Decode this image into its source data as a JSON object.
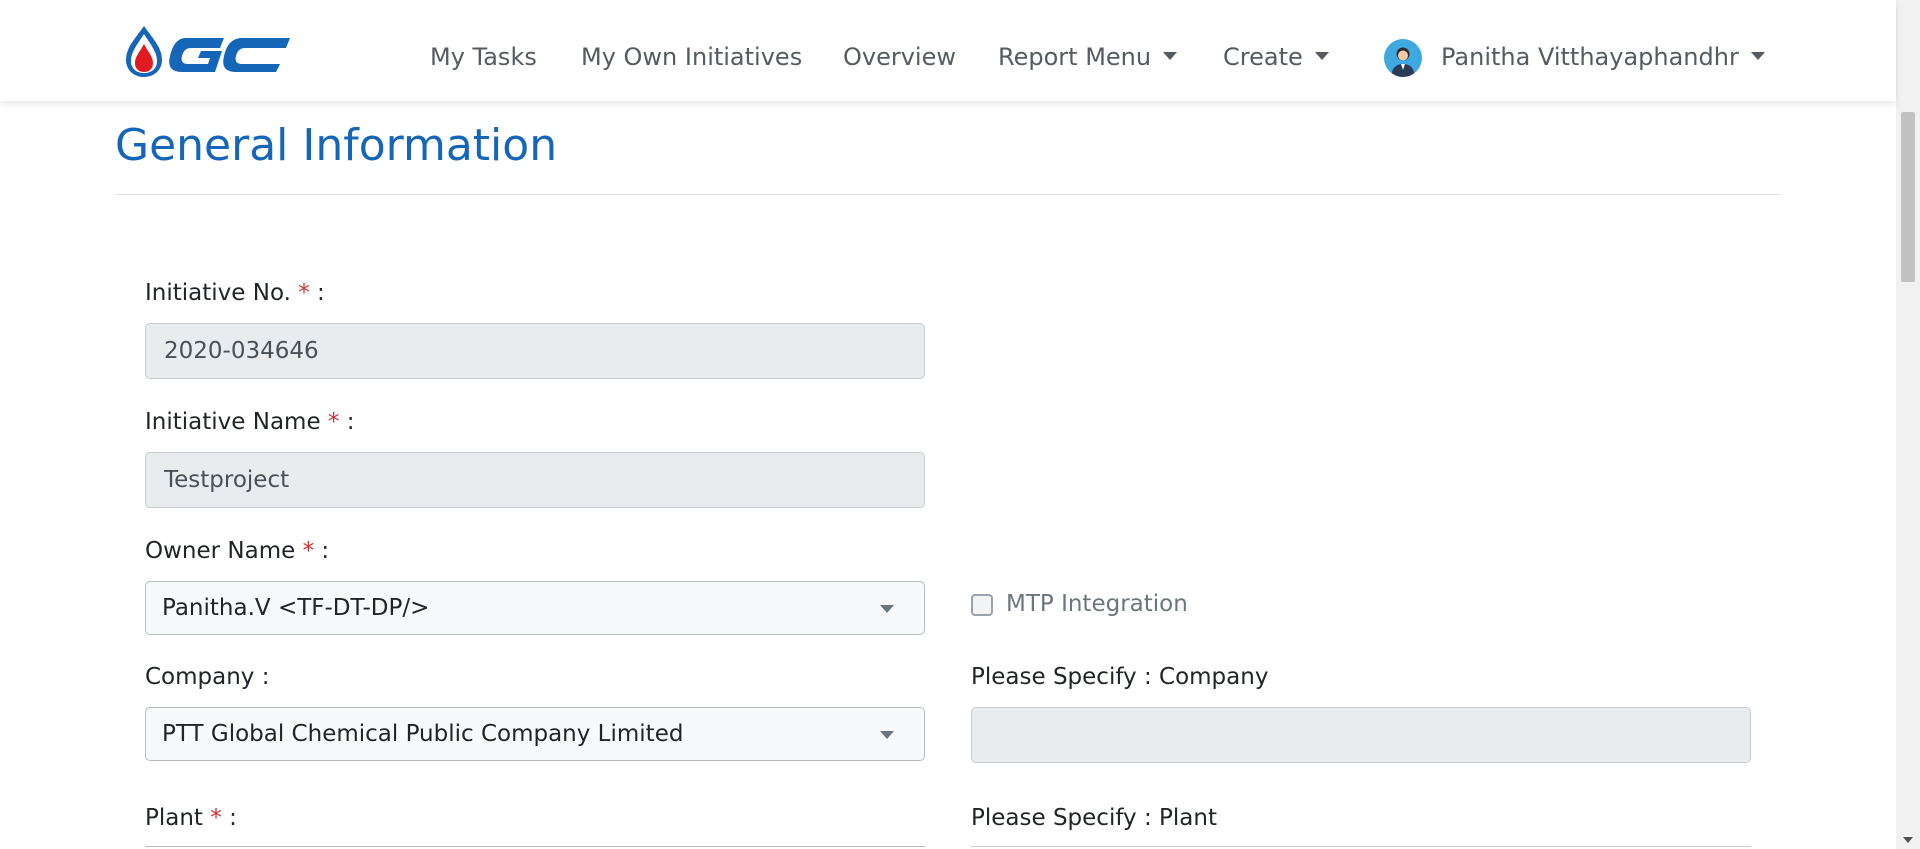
{
  "colors": {
    "brand_blue": "#1565b8",
    "logo_red": "#e11b22",
    "required_star": "#d32f2f",
    "readonly_input_bg": "#e9ecef"
  },
  "navbar": {
    "logo_icon": "gc-logo",
    "logo_text": "GC",
    "links": [
      {
        "label": "My Tasks"
      },
      {
        "label": "My Own Initiatives"
      },
      {
        "label": "Overview"
      },
      {
        "label": "Report Menu",
        "dropdown": true
      },
      {
        "label": "Create",
        "dropdown": true
      }
    ],
    "user": {
      "avatar_icon": "user-avatar-icon",
      "name": "Panitha Vitthayaphandhr"
    }
  },
  "page": {
    "title": "General Information"
  },
  "form": {
    "required_mark": "*",
    "colon": ":",
    "initiative_no": {
      "label": "Initiative No.",
      "value": "2020-034646",
      "readonly": true
    },
    "initiative_name": {
      "label": "Initiative Name",
      "value": "Testproject",
      "readonly": true
    },
    "owner_name": {
      "label": "Owner Name",
      "value": "Panitha.V <TF-DT-DP/>"
    },
    "mtp_integration": {
      "label": "MTP Integration",
      "checked": false
    },
    "company": {
      "label": "Company :",
      "value": "PTT Global Chemical Public Company Limited"
    },
    "specify_company": {
      "label": "Please Specify : Company",
      "value": ""
    },
    "plant": {
      "label": "Plant"
    },
    "specify_plant": {
      "label": "Please Specify : Plant"
    }
  }
}
